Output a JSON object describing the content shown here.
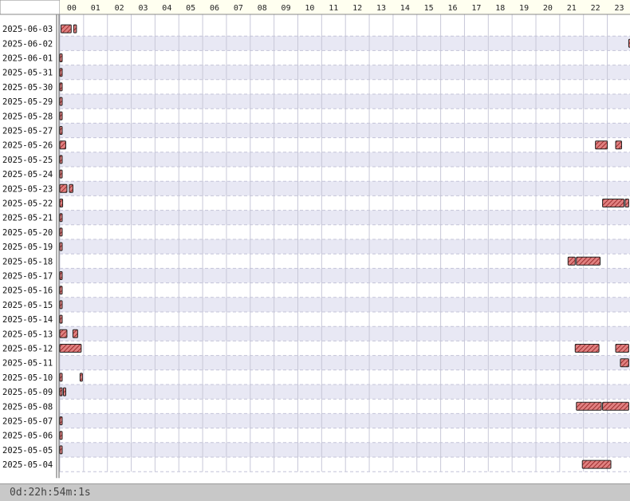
{
  "footer": {
    "uptime": "0d:22h:54m:1s"
  },
  "colors": {
    "bar_fill": "#e08080",
    "bar_stroke": "#222222",
    "hatch": "#8b1a1a",
    "row_alt": "#e8e8f4",
    "header_fill": "#fffff0"
  },
  "chart_data": {
    "type": "timeline",
    "hours": [
      "00",
      "01",
      "02",
      "03",
      "04",
      "05",
      "06",
      "07",
      "08",
      "09",
      "10",
      "11",
      "12",
      "13",
      "14",
      "15",
      "16",
      "17",
      "18",
      "19",
      "20",
      "21",
      "22",
      "23"
    ],
    "rows": [
      {
        "date": "2025-06-03",
        "segments": [
          [
            0.05,
            0.48
          ],
          [
            0.58,
            0.7
          ]
        ]
      },
      {
        "date": "2025-06-02",
        "segments": [
          [
            23.9,
            24.0
          ]
        ]
      },
      {
        "date": "2025-06-01",
        "segments": [
          [
            0.0,
            0.1
          ]
        ]
      },
      {
        "date": "2025-05-31",
        "segments": [
          [
            0.0,
            0.1
          ]
        ]
      },
      {
        "date": "2025-05-30",
        "segments": [
          [
            0.0,
            0.1
          ]
        ]
      },
      {
        "date": "2025-05-29",
        "segments": [
          [
            0.0,
            0.1
          ]
        ]
      },
      {
        "date": "2025-05-28",
        "segments": [
          [
            0.0,
            0.1
          ]
        ]
      },
      {
        "date": "2025-05-27",
        "segments": [
          [
            0.0,
            0.1
          ]
        ]
      },
      {
        "date": "2025-05-26",
        "segments": [
          [
            0.0,
            0.25
          ],
          [
            22.5,
            23.0
          ],
          [
            23.35,
            23.6
          ]
        ]
      },
      {
        "date": "2025-05-25",
        "segments": [
          [
            0.0,
            0.1
          ]
        ]
      },
      {
        "date": "2025-05-24",
        "segments": [
          [
            0.0,
            0.1
          ]
        ]
      },
      {
        "date": "2025-05-23",
        "segments": [
          [
            0.0,
            0.3
          ],
          [
            0.4,
            0.55
          ]
        ]
      },
      {
        "date": "2025-05-22",
        "segments": [
          [
            0.0,
            0.12
          ],
          [
            22.8,
            23.7
          ],
          [
            23.75,
            23.9
          ]
        ]
      },
      {
        "date": "2025-05-21",
        "segments": [
          [
            0.0,
            0.1
          ]
        ]
      },
      {
        "date": "2025-05-20",
        "segments": [
          [
            0.0,
            0.1
          ]
        ]
      },
      {
        "date": "2025-05-19",
        "segments": [
          [
            0.0,
            0.1
          ]
        ]
      },
      {
        "date": "2025-05-18",
        "segments": [
          [
            21.35,
            21.65
          ],
          [
            21.7,
            22.7
          ]
        ]
      },
      {
        "date": "2025-05-17",
        "segments": [
          [
            0.0,
            0.1
          ]
        ]
      },
      {
        "date": "2025-05-16",
        "segments": [
          [
            0.0,
            0.1
          ]
        ]
      },
      {
        "date": "2025-05-15",
        "segments": [
          [
            0.0,
            0.1
          ]
        ]
      },
      {
        "date": "2025-05-14",
        "segments": [
          [
            0.0,
            0.1
          ]
        ]
      },
      {
        "date": "2025-05-13",
        "segments": [
          [
            0.0,
            0.3
          ],
          [
            0.55,
            0.75
          ]
        ]
      },
      {
        "date": "2025-05-12",
        "segments": [
          [
            0.0,
            0.9
          ],
          [
            21.65,
            22.65
          ],
          [
            23.35,
            23.9
          ]
        ]
      },
      {
        "date": "2025-05-11",
        "segments": [
          [
            23.55,
            23.9
          ]
        ]
      },
      {
        "date": "2025-05-10",
        "segments": [
          [
            0.0,
            0.1
          ],
          [
            0.85,
            0.95
          ]
        ]
      },
      {
        "date": "2025-05-09",
        "segments": [
          [
            0.0,
            0.1
          ],
          [
            0.15,
            0.25
          ]
        ]
      },
      {
        "date": "2025-05-08",
        "segments": [
          [
            21.7,
            22.75
          ],
          [
            22.8,
            23.9
          ]
        ]
      },
      {
        "date": "2025-05-07",
        "segments": [
          [
            0.0,
            0.1
          ]
        ]
      },
      {
        "date": "2025-05-06",
        "segments": [
          [
            0.0,
            0.1
          ]
        ]
      },
      {
        "date": "2025-05-05",
        "segments": [
          [
            0.0,
            0.1
          ]
        ]
      },
      {
        "date": "2025-05-04",
        "segments": [
          [
            21.95,
            23.15
          ]
        ]
      }
    ]
  }
}
